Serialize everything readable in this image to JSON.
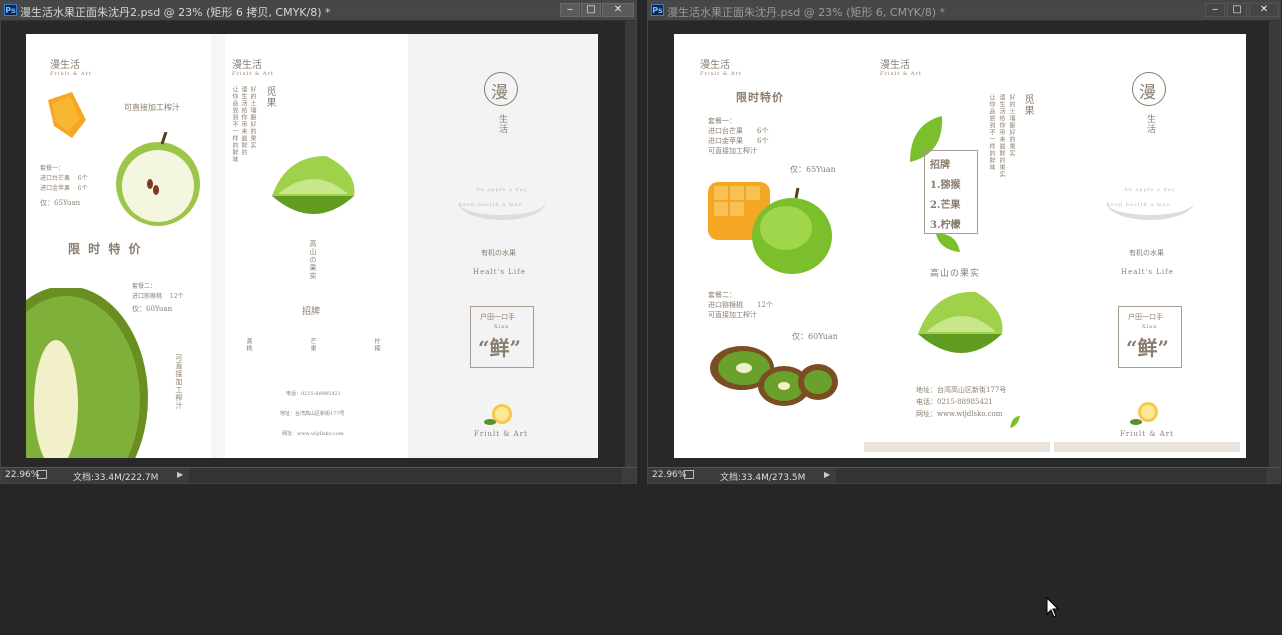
{
  "windows": [
    {
      "title": "漫生活水果正面朱沈丹2.psd @ 23% (矩形 6 拷贝, CMYK/8) *",
      "zoom": "22.96%",
      "doc_size": "文档:33.4M/222.7M",
      "buttons": {
        "minimize": "‒",
        "maximize": "□",
        "close": "✕"
      },
      "design": {
        "brand_logo": "漫生活",
        "brand_sub": "Friult & Art",
        "p1_direct": "可直接加工榨汁",
        "p1_set1_title": "套餐一：",
        "p1_set1_line1": "进口台芒果 　6个",
        "p1_set1_line2": "进口金苹果 　6个",
        "p1_price1": "仅：65Yuan",
        "p1_promo": "限 时 特 价",
        "p1_set2_title": "套餐二：",
        "p1_set2_line1": "进口猕猴桃 　12个",
        "p1_price2": "仅：60Yuan",
        "p1_vertical": "可直接加工榨汁",
        "p2_fruit_head": "觅果",
        "p2_text_col1": "好的土壤酿好的果实",
        "p2_text_col2": "漫生活给你带来最鲜的",
        "p2_text_col3": "让你品尝到不一样的鲜味",
        "p2_vert_title": "高山の果实",
        "p2_sign": "招牌",
        "p2_item1": "蒸桃",
        "p2_item2": "芒果",
        "p2_item3": "柠檬",
        "p2_phone": "电话：0215-88985421",
        "p2_address": "地址：台湾高山区新街177号",
        "p2_web": "网址：www.wijdlsko.com",
        "p3_big_logo": "漫",
        "p3_big_logo2": "生活",
        "p3_en1": "An apple a day",
        "p3_en2": "keep health a man",
        "p3_organic": "有机の水果",
        "p3_healthy": "Healt's Life",
        "p3_box_top": "户田一口手",
        "p3_box_en": "Xian",
        "p3_box_big": "“鲜”",
        "p3_footer": "Friult & Art"
      }
    },
    {
      "title": "漫生活水果正面朱沈丹.psd @ 23% (矩形 6, CMYK/8) *",
      "zoom": "22.96%",
      "doc_size": "文档:33.4M/273.5M",
      "buttons": {
        "minimize": "‒",
        "maximize": "□",
        "close": "✕"
      },
      "design": {
        "brand_logo": "漫生活",
        "brand_sub": "Friult & Art",
        "p1_heading": "限时特价",
        "p1_set1_title": "套餐一：",
        "p1_set1_line1": "进口台芒果　　6个",
        "p1_set1_line2": "进口金苹果　　6个",
        "p1_set1_line3": "可直接加工榨汁",
        "p1_price1": "仅：65Yuan",
        "p1_set2_title": "套餐二：",
        "p1_set2_line1": "进口猕猴桃　　12个",
        "p1_set2_line2": "可直接加工榨汁",
        "p1_price2": "仅：60Yuan",
        "p2_fruit_head": "觅果",
        "p2_text_col1": "好的土壤酿好的果实",
        "p2_text_col2": "漫生活给你带来最鲜的果实",
        "p2_text_col3": "让你品尝到不一样的鲜味",
        "p2_menu_row1": "招牌",
        "p2_menu_row2": "1.猕猴",
        "p2_menu_row3": "2.芒果",
        "p2_menu_row4": "3.柠檬",
        "p2_subtitle": "高山の果实",
        "p2_addr": "地址：台湾高山区新街177号",
        "p2_phone": "电话：0215-88985421",
        "p2_web": "网址：www.wijdlsko.com",
        "p3_big_logo": "漫",
        "p3_big_logo2": "生活",
        "p3_en1": "An apple a day",
        "p3_en2": "keep health a man",
        "p3_organic": "有机の水果",
        "p3_healthy": "Healt's Life",
        "p3_box_top": "户田一口手",
        "p3_box_en": "Xian",
        "p3_box_big": "“鲜”",
        "p3_footer": "Friult & Art"
      }
    }
  ],
  "colors": {
    "workspace": "#262626",
    "titlebar": "#474747",
    "text_brown": "#8a7d6f",
    "lime": "#8cc63f"
  }
}
